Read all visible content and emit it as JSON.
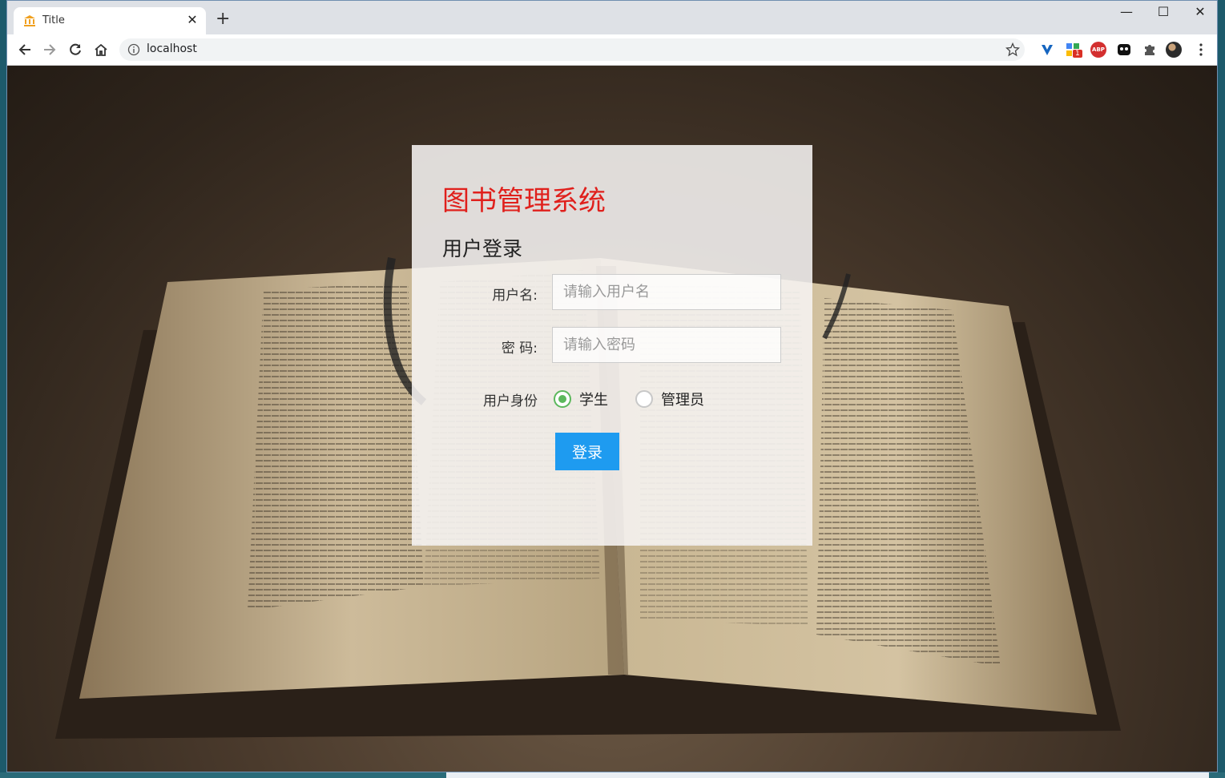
{
  "browser": {
    "tab_title": "Title",
    "tab_close": "✕",
    "new_tab": "+",
    "url": "localhost",
    "minimize": "—",
    "maximize": "☐",
    "close": "✕",
    "extensions": [
      "vpn-extension-icon",
      "extension-badge-icon",
      "adblock-icon",
      "ghost-extension-icon",
      "puzzle-extensions-icon",
      "profile-avatar",
      "menu-icon"
    ],
    "ext_badge_count": "1",
    "adblock_label": "ABP"
  },
  "page": {
    "brand": "图书管理系统",
    "subtitle": "用户登录",
    "username_label": "用户名:",
    "username_placeholder": "请输入用户名",
    "password_label": "密 码:",
    "password_placeholder": "请输入密码",
    "role_label": "用户身份",
    "roles": [
      {
        "label": "学生",
        "selected": true
      },
      {
        "label": "管理员",
        "selected": false
      }
    ],
    "login_button": "登录"
  },
  "colors": {
    "brand": "#e0201c",
    "button": "#1e9bf0",
    "radio_selected": "#5cb85c"
  }
}
